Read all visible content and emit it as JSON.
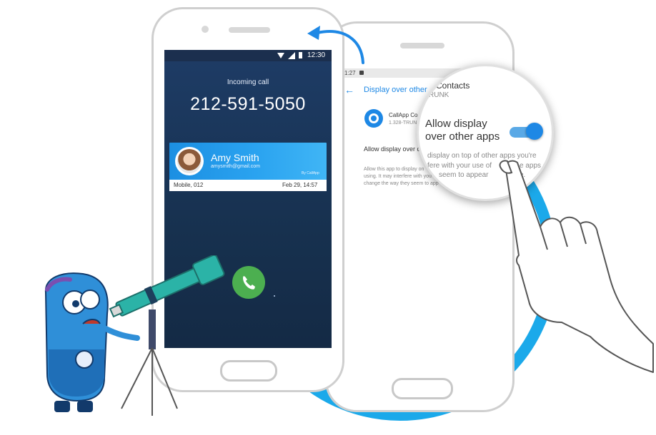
{
  "colors": {
    "accent": "#1ba9ea",
    "screen_bg": "#1e3c66",
    "answer_green": "#4caf50",
    "settings_blue": "#1e88e5"
  },
  "front_phone": {
    "status_time": "12:30",
    "incoming_label": "Incoming call",
    "phone_number": "212-591-5050",
    "contact_name": "Amy Smith",
    "contact_email": "amysmith@gmail.com",
    "card_brand": "By CallApp",
    "call_type": "Mobile, 012",
    "call_date": "Feb 29, 14:57",
    "answer_icon": "phone-icon"
  },
  "back_phone": {
    "status_time": "1:27",
    "header_title": "Display over other",
    "app_name": "CallApp Co",
    "app_version": "1.328-TRUN",
    "setting_row": "Allow display over o",
    "description": "Allow this app to display on",
    "description_line2": "using. It may interfere with you",
    "description_line3": "change the way they seem to app"
  },
  "magnifier": {
    "app_name": "Contacts",
    "app_version": "RUNK",
    "toggle_label_line1": "Allow display",
    "toggle_label_line2": "over other apps",
    "toggle_on": true,
    "desc_line1": "display on top of other apps you're",
    "desc_line2": "fere with your use of",
    "desc_line2b": "e apps or",
    "desc_line3": "seem to appear",
    "desc_line3b": "e."
  }
}
